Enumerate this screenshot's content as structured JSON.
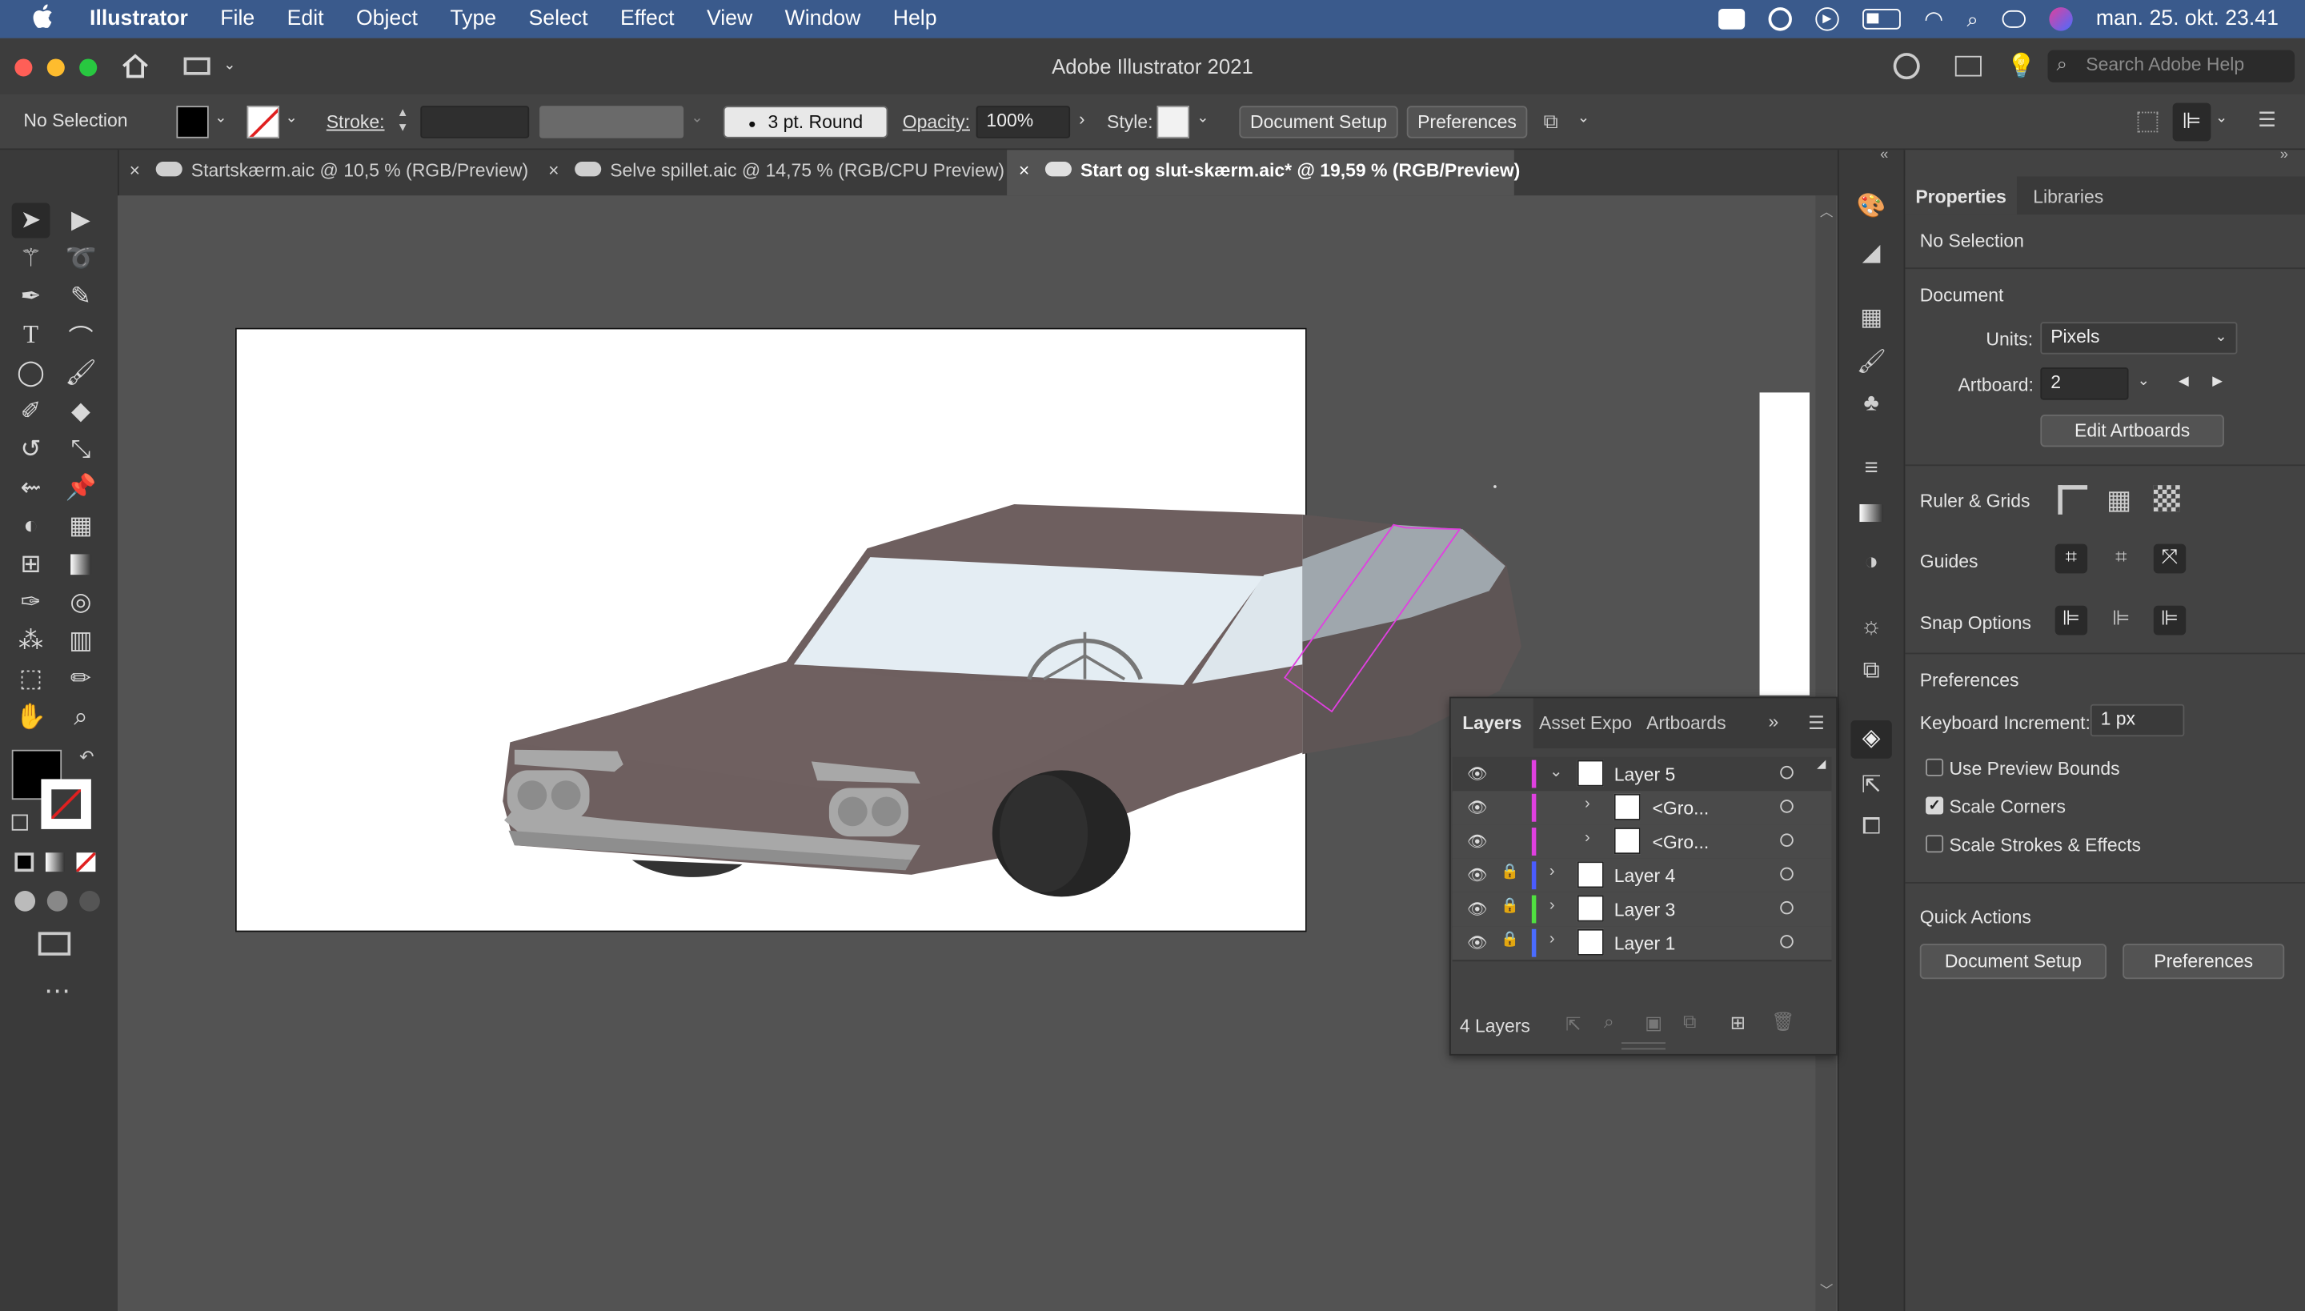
{
  "menubar": {
    "apple_icon": "apple-icon",
    "app_name": "Illustrator",
    "items": [
      "File",
      "Edit",
      "Object",
      "Type",
      "Select",
      "Effect",
      "View",
      "Window",
      "Help"
    ],
    "clock": "man. 25. okt. 23.41"
  },
  "window": {
    "title": "Adobe Illustrator 2021",
    "search_placeholder": "Search Adobe Help"
  },
  "control_bar": {
    "selection_label": "No Selection",
    "stroke_label": "Stroke:",
    "brush_label": "3 pt. Round",
    "opacity_label": "Opacity:",
    "opacity_value": "100%",
    "style_label": "Style:",
    "document_setup": "Document Setup",
    "preferences": "Preferences"
  },
  "tabs": [
    {
      "label": "Startskærm.aic @ 10,5 % (RGB/Preview)",
      "active": false
    },
    {
      "label": "Selve spillet.aic @ 14,75 % (RGB/CPU Preview)",
      "active": false
    },
    {
      "label": "Start og slut-skærm.aic* @ 19,59 % (RGB/Preview)",
      "active": true
    }
  ],
  "properties": {
    "tabs": [
      "Properties",
      "Libraries"
    ],
    "selection": "No Selection",
    "document_heading": "Document",
    "units_label": "Units:",
    "units_value": "Pixels",
    "artboard_label": "Artboard:",
    "artboard_value": "2",
    "edit_artboards": "Edit Artboards",
    "ruler_grids": "Ruler & Grids",
    "guides": "Guides",
    "snap_options": "Snap Options",
    "preferences_heading": "Preferences",
    "keyboard_increment_label": "Keyboard Increment:",
    "keyboard_increment_value": "1 px",
    "use_preview_bounds": "Use Preview Bounds",
    "scale_corners": "Scale Corners",
    "scale_strokes": "Scale Strokes & Effects",
    "use_preview_bounds_checked": false,
    "scale_corners_checked": true,
    "scale_strokes_checked": false,
    "quick_actions": "Quick Actions",
    "qa_document_setup": "Document Setup",
    "qa_preferences": "Preferences"
  },
  "layers_panel": {
    "tabs": [
      "Layers",
      "Asset Expo",
      "Artboards"
    ],
    "rows": [
      {
        "name": "Layer 5",
        "color": "#e040e0",
        "locked": false,
        "expanded": true,
        "indent": 0
      },
      {
        "name": "<Gro...",
        "color": "#e040e0",
        "locked": false,
        "expanded": false,
        "indent": 1
      },
      {
        "name": "<Gro...",
        "color": "#e040e0",
        "locked": false,
        "expanded": false,
        "indent": 1
      },
      {
        "name": "Layer 4",
        "color": "#4a5cff",
        "locked": true,
        "expanded": false,
        "indent": 0
      },
      {
        "name": "Layer 3",
        "color": "#50e040",
        "locked": true,
        "expanded": false,
        "indent": 0
      },
      {
        "name": "Layer 1",
        "color": "#4a6cff",
        "locked": true,
        "expanded": false,
        "indent": 0
      }
    ],
    "count_label": "4 Layers"
  },
  "colors": {
    "car_body": "#6e5f5f",
    "windshield": "#e4edf3",
    "selection_outline": "#e040e0"
  }
}
